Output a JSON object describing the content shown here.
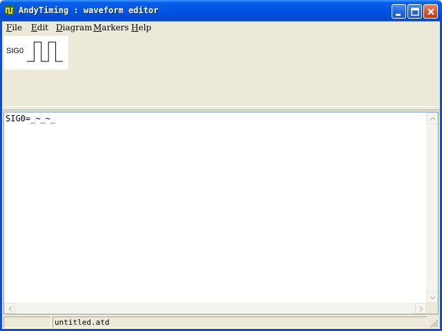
{
  "window": {
    "title": "AndyTiming : waveform editor"
  },
  "menu": {
    "items": [
      {
        "key": "F",
        "rest": "ile"
      },
      {
        "key": "E",
        "rest": "dit"
      },
      {
        "key": "D",
        "rest": "iagram"
      },
      {
        "key": "M",
        "rest": "arkers"
      },
      {
        "key": "H",
        "rest": "elp"
      }
    ]
  },
  "diagram": {
    "signals": [
      {
        "name": "SIG0",
        "levels": [
          0,
          1,
          0,
          1,
          0
        ]
      }
    ]
  },
  "editor": {
    "content": "SIG0=_~_~_"
  },
  "statusbar": {
    "left": "",
    "filename": "untitled.atd"
  },
  "icons": {
    "app": "andytiming-app-icon",
    "minimize": "minimize-icon",
    "maximize": "maximize-icon",
    "close": "close-icon"
  },
  "colors": {
    "titlebar": "#0055e3",
    "window_bg": "#ece9d8",
    "close_button": "#d5502a"
  }
}
